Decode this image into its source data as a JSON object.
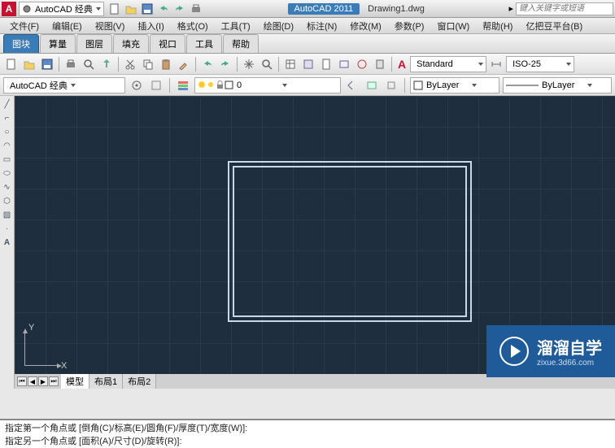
{
  "title": {
    "suite": "AutoCAD 经典",
    "app": "AutoCAD 2011",
    "doc": "Drawing1.dwg",
    "search_placeholder": "键入关键字或短语"
  },
  "menu": [
    "文件(F)",
    "编辑(E)",
    "视图(V)",
    "插入(I)",
    "格式(O)",
    "工具(T)",
    "绘图(D)",
    "标注(N)",
    "修改(M)",
    "参数(P)",
    "窗口(W)",
    "帮助(H)",
    "亿把豆平台(B)"
  ],
  "tabs": [
    "图块",
    "算量",
    "图层",
    "填充",
    "视口",
    "工具",
    "帮助"
  ],
  "active_tab": 0,
  "styles": {
    "text_style": "Standard",
    "dim_style": "ISO-25",
    "workspace": "AutoCAD 经典",
    "layer_state": "ByLayer",
    "lineweight": "ByLayer",
    "layer0": "0"
  },
  "colors": {
    "accent": "#3a7cb8",
    "brand": "#c41230",
    "canvas": "#1e2e3e",
    "draw": "#c8d8e8"
  },
  "ucs": {
    "x": "X",
    "y": "Y"
  },
  "canvas_tabs": [
    "模型",
    "布局1",
    "布局2"
  ],
  "cmd": {
    "line1": "指定第一个角点或 [倒角(C)/标高(E)/圆角(F)/厚度(T)/宽度(W)]:",
    "line2": "指定另一个角点或 [面积(A)/尺寸(D)/旋转(R)]:"
  },
  "watermark": {
    "brand": "溜溜自学",
    "sub": "zixue.3d66.com"
  },
  "icons": {
    "letter": "A"
  }
}
